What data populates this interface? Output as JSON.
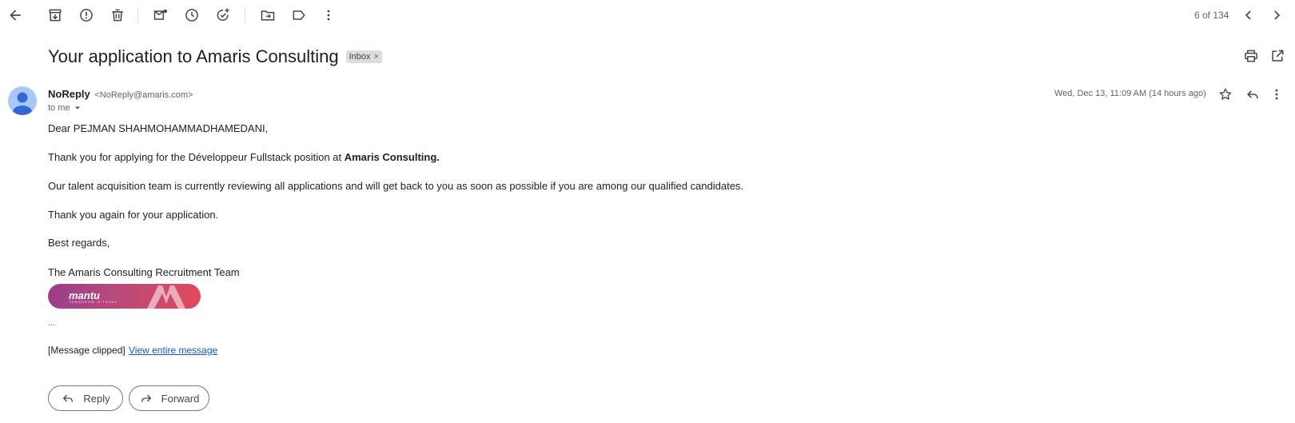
{
  "toolbar": {
    "pager_text": "6 of 134",
    "icons": [
      "back-arrow-icon",
      "archive-icon",
      "report-spam-icon",
      "delete-icon",
      "mark-unread-icon",
      "snooze-icon",
      "add-task-icon",
      "move-to-icon",
      "label-icon",
      "more-vert-icon",
      "newer-icon",
      "older-icon"
    ]
  },
  "email": {
    "subject": "Your application to Amaris Consulting",
    "label": "Inbox",
    "label_remove": "×",
    "sender_name": "NoReply",
    "sender_email": "<NoReply@amaris.com>",
    "to_me": "to me",
    "date": "Wed, Dec 13, 11:09 AM (14 hours ago)",
    "body": {
      "greeting": "Dear PEJMAN SHAHMOHAMMADHAMEDANI,",
      "line1_prefix": "Thank you for applying for the Développeur Fullstack position at ",
      "line1_bold": "Amaris Consulting.",
      "line2": "Our talent acquisition team is currently reviewing all applications and will get back to you as soon as possible if you are among our qualified candidates.",
      "line3": "Thank you again for your application.",
      "line4": "Best regards,",
      "signature": "The Amaris Consulting Recruitment Team"
    },
    "banner_text": "mantu",
    "banner_sub": "TOMORROW IS TODAY",
    "ellipsis": "...",
    "clipped_text": "[Message clipped]",
    "view_entire_label": "View entire message"
  },
  "actions": {
    "reply_label": "Reply",
    "forward_label": "Forward"
  },
  "colors": {
    "link": "#1a55c7",
    "avatar_bg": "#a8c7fa",
    "avatar_fg": "#3367d6",
    "chip_bg": "#dddddd"
  }
}
